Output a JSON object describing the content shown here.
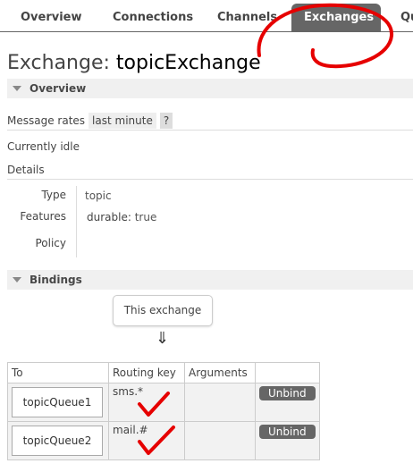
{
  "nav": {
    "tabs": [
      {
        "label": "Overview"
      },
      {
        "label": "Connections"
      },
      {
        "label": "Channels"
      },
      {
        "label": "Exchanges",
        "active": true
      },
      {
        "label": "Qu"
      }
    ]
  },
  "title": {
    "prefix": "Exchange: ",
    "name": "topicExchange"
  },
  "overview": {
    "header": "Overview",
    "message_rates_label": "Message rates",
    "message_rates_range": "last minute",
    "help": "?",
    "status": "Currently idle",
    "details_label": "Details"
  },
  "details": {
    "type_label": "Type",
    "type_value": "topic",
    "features_label": "Features",
    "features_key": "durable:",
    "features_value": "true",
    "policy_label": "Policy"
  },
  "bindings": {
    "header": "Bindings",
    "this_exchange": "This exchange",
    "arrow": "⇓",
    "columns": [
      "To",
      "Routing key",
      "Arguments",
      ""
    ],
    "rows": [
      {
        "to": "topicQueue1",
        "routing_key": "sms.*",
        "action": "Unbind"
      },
      {
        "to": "topicQueue2",
        "routing_key": "mail.#",
        "action": "Unbind"
      }
    ]
  },
  "colors": {
    "active_tab": "#666666",
    "annotation": "#e60000",
    "section_bg": "#f0f0f0"
  }
}
